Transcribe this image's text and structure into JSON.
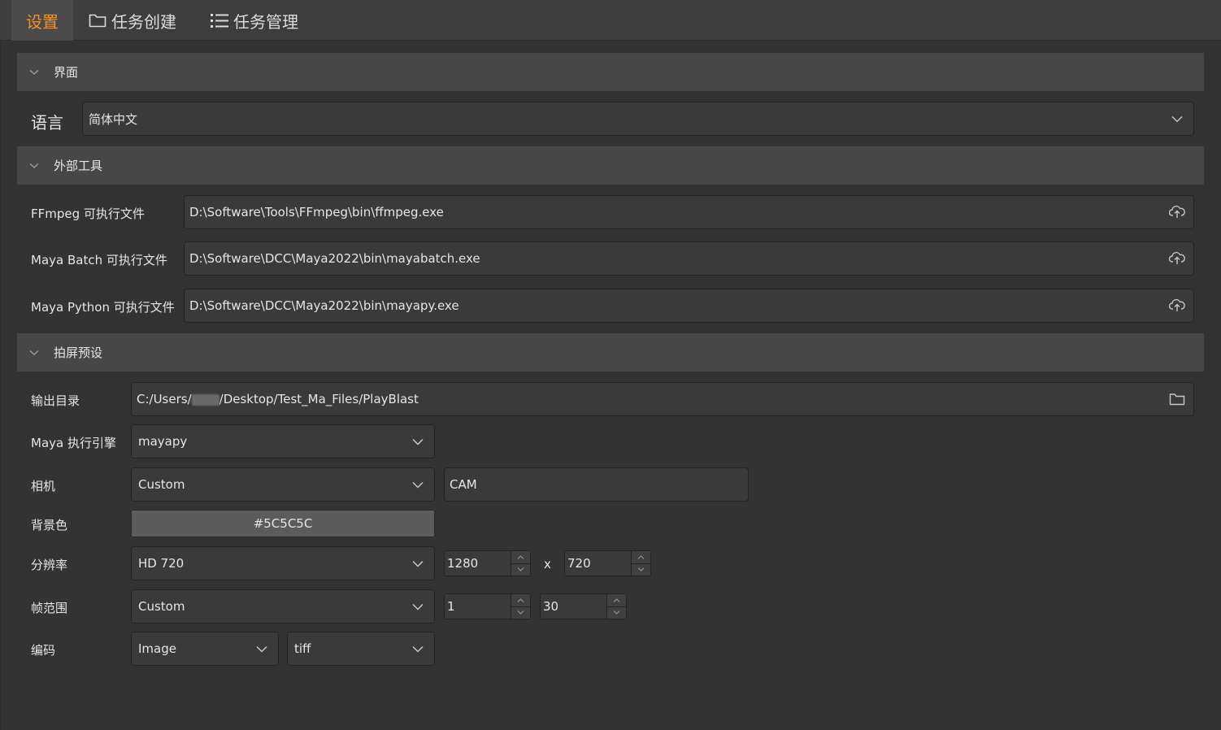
{
  "tabs": [
    {
      "label": "设置",
      "icon": "",
      "active": true
    },
    {
      "label": "任务创建",
      "icon": "folder-icon",
      "active": false
    },
    {
      "label": "任务管理",
      "icon": "list-icon",
      "active": false
    }
  ],
  "sections": {
    "interface": {
      "title": "界面",
      "language_label": "语言",
      "language_value": "简体中文"
    },
    "external_tools": {
      "title": "外部工具",
      "ffmpeg_label": "FFmpeg 可执行文件",
      "ffmpeg_path": "D:\\Software\\Tools\\FFmpeg\\bin\\ffmpeg.exe",
      "mayabatch_label": "Maya Batch 可执行文件",
      "mayabatch_path": "D:\\Software\\DCC\\Maya2022\\bin\\mayabatch.exe",
      "mayapy_label": "Maya Python 可执行文件",
      "mayapy_path": "D:\\Software\\DCC\\Maya2022\\bin\\mayapy.exe"
    },
    "playblast": {
      "title": "拍屏预设",
      "output_label": "输出目录",
      "output_prefix": "C:/Users/",
      "output_suffix": "/Desktop/Test_Ma_Files/PlayBlast",
      "engine_label": "Maya 执行引擎",
      "engine_value": "mayapy",
      "camera_label": "相机",
      "camera_mode": "Custom",
      "camera_name": "CAM",
      "bg_label": "背景色",
      "bg_value": "#5C5C5C",
      "resolution_label": "分辨率",
      "resolution_preset": "HD 720",
      "res_width": "1280",
      "res_x": "x",
      "res_height": "720",
      "frame_label": "帧范围",
      "frame_mode": "Custom",
      "frame_start": "1",
      "frame_end": "30",
      "codec_label": "编码",
      "codec_format": "Image",
      "codec_type": "tiff"
    }
  },
  "colors": {
    "accent": "#f0932b",
    "background": "#333333",
    "section_header": "#474747",
    "field": "#3a3a3a"
  }
}
